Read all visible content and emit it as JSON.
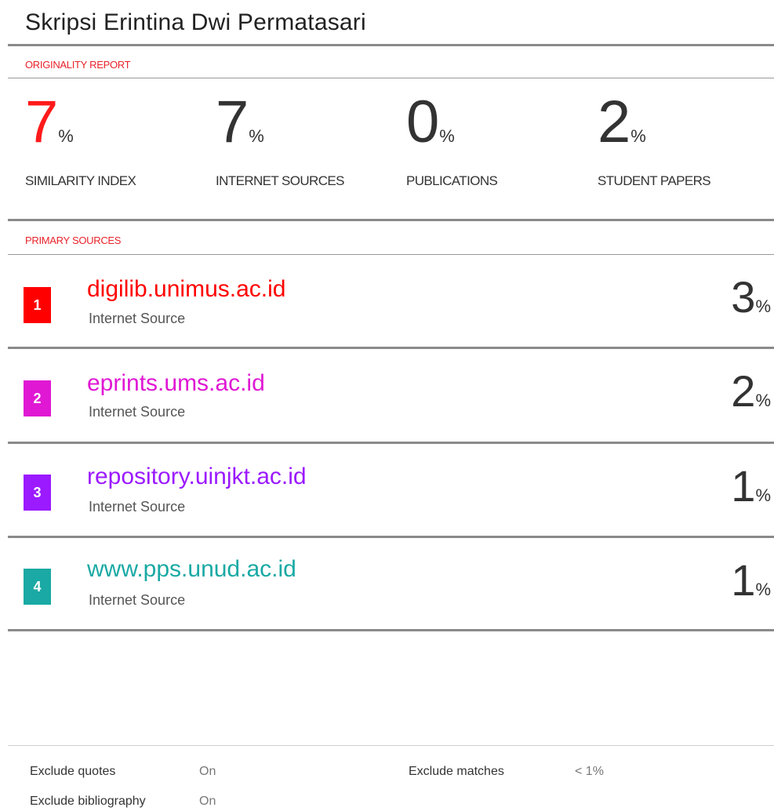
{
  "title": "Skripsi Erintina Dwi Permatasari",
  "originality_label": "ORIGINALITY REPORT",
  "stats": [
    {
      "value": "7",
      "unit": "%",
      "label": "SIMILARITY INDEX"
    },
    {
      "value": "7",
      "unit": "%",
      "label": "INTERNET SOURCES"
    },
    {
      "value": "0",
      "unit": "%",
      "label": "PUBLICATIONS"
    },
    {
      "value": "2",
      "unit": "%",
      "label": "STUDENT PAPERS"
    }
  ],
  "primary_label": "PRIMARY SOURCES",
  "sources": [
    {
      "rank": "1",
      "name": "digilib.unimus.ac.id",
      "type": "Internet Source",
      "percent": "3",
      "unit": "%",
      "color": "#ff0000"
    },
    {
      "rank": "2",
      "name": "eprints.ums.ac.id",
      "type": "Internet Source",
      "percent": "2",
      "unit": "%",
      "color": "#e018d4"
    },
    {
      "rank": "3",
      "name": "repository.uinjkt.ac.id",
      "type": "Internet Source",
      "percent": "1",
      "unit": "%",
      "color": "#9b1aff"
    },
    {
      "rank": "4",
      "name": "www.pps.unud.ac.id",
      "type": "Internet Source",
      "percent": "1",
      "unit": "%",
      "color": "#1aa9a4"
    }
  ],
  "footer": {
    "exclude_quotes_label": "Exclude quotes",
    "exclude_quotes_value": "On",
    "exclude_bibliography_label": "Exclude bibliography",
    "exclude_bibliography_value": "On",
    "exclude_matches_label": "Exclude matches",
    "exclude_matches_value": "< 1%"
  }
}
